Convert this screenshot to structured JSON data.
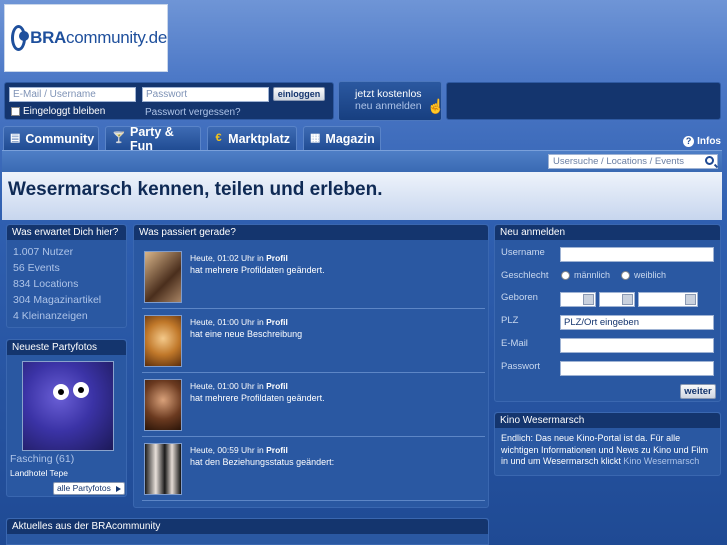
{
  "logo": {
    "text_bold": "BRA",
    "text_rest": "community.de"
  },
  "login": {
    "email_placeholder": "E-Mail / Username",
    "password_placeholder": "Passwort",
    "login_button": "einloggen",
    "remember_label": "Eingeloggt bleiben",
    "forgot_link": "Passwort vergessen?",
    "register_line1": "jetzt kostenlos",
    "register_line2": "neu anmelden"
  },
  "nav": {
    "tabs": [
      {
        "label": "Community",
        "icon": "chat-icon"
      },
      {
        "label": "Party & Fun",
        "icon": "cocktail-icon"
      },
      {
        "label": "Marktplatz",
        "icon": "euro-icon"
      },
      {
        "label": "Magazin",
        "icon": "newspaper-icon"
      }
    ],
    "infos_label": "Infos"
  },
  "search": {
    "placeholder": "Usersuche / Locations / Events"
  },
  "headline": "Wesermarsch kennen, teilen und erleben.",
  "expect": {
    "title": "Was erwartet Dich hier?",
    "stats": [
      "1.007 Nutzer",
      "56 Events",
      "834 Locations",
      "304 Magazinartikel",
      "4 Kleinanzeigen"
    ]
  },
  "partyfotos": {
    "title": "Neueste Partyfotos",
    "caption": "Fasching (61)",
    "location": "Landhotel Tepe",
    "all_button": "alle Partyfotos"
  },
  "activity": {
    "title": "Was passiert gerade?",
    "items": [
      {
        "time": "Heute, 01:02 Uhr in",
        "section": "Profil",
        "message": "hat mehrere Profildaten geändert."
      },
      {
        "time": "Heute, 01:00 Uhr in",
        "section": "Profil",
        "message": "hat eine neue Beschreibung"
      },
      {
        "time": "Heute, 01:00 Uhr in",
        "section": "Profil",
        "message": "hat mehrere Profildaten geändert."
      },
      {
        "time": "Heute, 00:59 Uhr in",
        "section": "Profil",
        "message": "hat den Beziehungsstatus geändert:"
      }
    ]
  },
  "register": {
    "title": "Neu anmelden",
    "username_label": "Username",
    "gender_label": "Geschlecht",
    "male_label": "männlich",
    "female_label": "weiblich",
    "born_label": "Geboren",
    "plz_label": "PLZ",
    "plz_value": "PLZ/Ort eingeben",
    "email_label": "E-Mail",
    "password_label": "Passwort",
    "submit": "weiter"
  },
  "kino": {
    "title": "Kino Wesermarsch",
    "text": "Endlich: Das neue Kino-Portal ist da. Für alle wichtigen Informationen und News zu Kino und Film in und um Wesermarsch klickt",
    "link": "Kino Wesermarsch"
  },
  "news": {
    "title": "Aktuelles aus der BRAcommunity"
  }
}
